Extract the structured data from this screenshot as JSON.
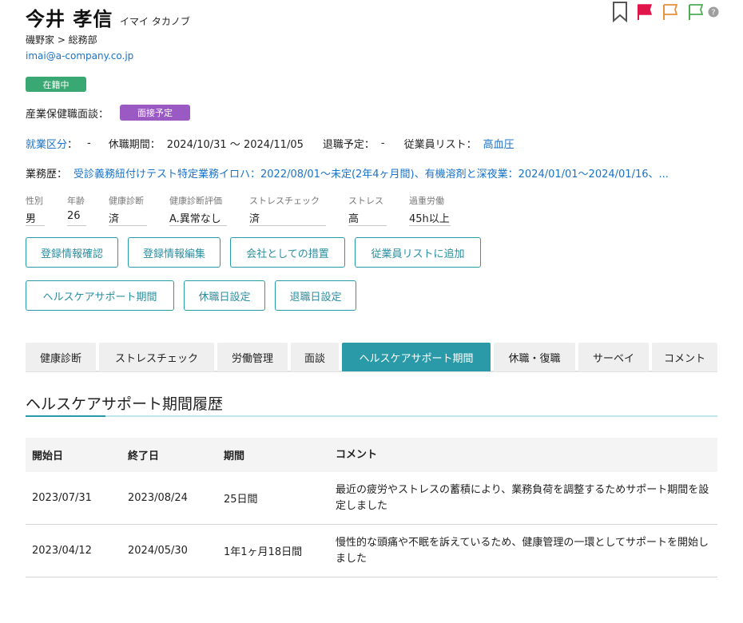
{
  "employee": {
    "name": "今井 孝信",
    "kana": "イマイ タカノブ",
    "department_path": "磯野家 > 総務部",
    "email": "imai@a-company.co.jp",
    "status_badge": "在籍中"
  },
  "icons": {
    "bookmark": "bookmark-icon",
    "flag_red": "flag-red-icon",
    "flag_orange": "flag-orange-icon",
    "flag_green": "flag-green-icon",
    "help": "help-icon"
  },
  "colors": {
    "accent": "#2a9aa8",
    "link": "#1a73c9",
    "status_green": "#3aa873",
    "badge_purple": "#9b59c4",
    "flag_red": "#e0154a",
    "flag_orange": "#e8913a",
    "flag_green": "#4caf50"
  },
  "interview": {
    "label": "産業保健職面談：",
    "badge": "面接予定"
  },
  "info_line": {
    "employment_label": "就業区分",
    "employment_suffix": "：",
    "employment_value": "-",
    "leave_label": "休職期間：",
    "leave_value": "2024/10/31 〜 2024/11/05",
    "retire_label": "退職予定：",
    "retire_value": "-",
    "list_label": "従業員リスト：",
    "list_value": "高血圧"
  },
  "work_history": {
    "label": "業務歴：",
    "value": "受診義務紐付けテスト特定業務イロハ：2022/08/01〜未定(2年4ヶ月間)、有機溶剤と深夜業：2024/01/01〜2024/01/16、..."
  },
  "fields": [
    {
      "label": "性別",
      "value": "男"
    },
    {
      "label": "年齢",
      "value": "26"
    },
    {
      "label": "健康診断",
      "value": "済"
    },
    {
      "label": "健康診断評価",
      "value": "A.異常なし"
    },
    {
      "label": "ストレスチェック",
      "value": "済"
    },
    {
      "label": "ストレス",
      "value": "高"
    },
    {
      "label": "過重労働",
      "value": "45h以上"
    }
  ],
  "buttons": {
    "confirm": "登録情報確認",
    "edit": "登録情報編集",
    "measures": "会社としての措置",
    "add_list": "従業員リストに追加",
    "healthcare": "ヘルスケアサポート期間",
    "leave_date": "休職日設定",
    "retire_date": "退職日設定"
  },
  "tabs": [
    {
      "label": "健康診断"
    },
    {
      "label": "ストレスチェック"
    },
    {
      "label": "労働管理"
    },
    {
      "label": "面談"
    },
    {
      "label": "ヘルスケアサポート期間"
    },
    {
      "label": "休職・復職"
    },
    {
      "label": "サーベイ"
    },
    {
      "label": "コメント"
    }
  ],
  "section": {
    "title": "ヘルスケアサポート期間履歴"
  },
  "table": {
    "headers": [
      "開始日",
      "終了日",
      "期間",
      "コメント"
    ],
    "rows": [
      [
        "2023/07/31",
        "2023/08/24",
        "25日間",
        "最近の疲労やストレスの蓄積により、業務負荷を調整するためサポート期間を設定しました"
      ],
      [
        "2023/04/12",
        "2024/05/30",
        "1年1ヶ月18日間",
        "慢性的な頭痛や不眠を訴えているため、健康管理の一環としてサポートを開始しました"
      ]
    ]
  }
}
